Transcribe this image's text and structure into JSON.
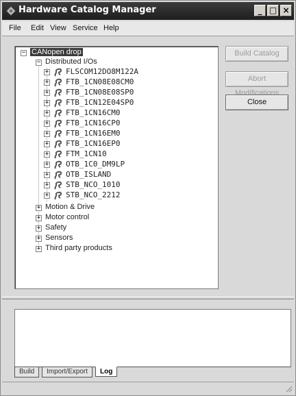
{
  "window": {
    "title": "Hardware Catalog Manager",
    "controls": {
      "minimize": "_",
      "maximize": "□",
      "close": "×"
    }
  },
  "menu": [
    "File",
    "Edit",
    "View",
    "Service",
    "Help"
  ],
  "tree": {
    "root": "CANopen drop",
    "distributed": {
      "label": "Distributed I/Os",
      "items": [
        "FLSCOM12DO8M122A",
        "FTB_1CN08E08CM0",
        "FTB_1CN08E08SP0",
        "FTB_1CN12E04SP0",
        "FTB_1CN16CM0",
        "FTB_1CN16CP0",
        "FTB_1CN16EM0",
        "FTB_1CN16EP0",
        "FTM_1CN10",
        "OTB_1C0_DM9LP",
        "OTB_ISLAND",
        "STB_NCO_1010",
        "STB_NCO_2212"
      ]
    },
    "categories": [
      "Motion & Drive",
      "Motor control",
      "Safety",
      "Sensors",
      "Third party products"
    ]
  },
  "buttons": {
    "build_catalog": "Build Catalog",
    "abort_modifications": "Abort Modifications",
    "close": "Close"
  },
  "tabs": [
    "Build",
    "Import/Export",
    "Log"
  ],
  "active_tab": "Log"
}
